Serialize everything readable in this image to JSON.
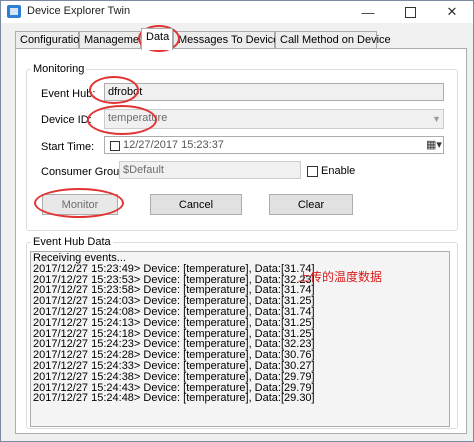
{
  "window": {
    "title": "Device Explorer Twin"
  },
  "tabs": [
    {
      "label": "Configuration"
    },
    {
      "label": "Management"
    },
    {
      "label": "Data"
    },
    {
      "label": "Messages To Device"
    },
    {
      "label": "Call Method on Device"
    }
  ],
  "monitoring": {
    "legend": "Monitoring",
    "event_hub_label": "Event Hub:",
    "event_hub_value": "dfrobot",
    "device_id_label": "Device ID:",
    "device_id_value": "temperature",
    "start_time_label": "Start Time:",
    "start_time_value": "12/27/2017 15:23:37",
    "consumer_group_label": "Consumer Group:",
    "consumer_group_value": "$Default",
    "enable_label": "Enable",
    "monitor_button": "Monitor",
    "cancel_button": "Cancel",
    "clear_button": "Clear"
  },
  "event_hub_data": {
    "legend": "Event Hub Data",
    "lines": [
      "Receiving events...",
      "2017/12/27 15:23:49> Device: [temperature], Data:[31.74]",
      "2017/12/27 15:23:53> Device: [temperature], Data:[32.23]",
      "2017/12/27 15:23:58> Device: [temperature], Data:[31.74]",
      "2017/12/27 15:24:03> Device: [temperature], Data:[31.25]",
      "2017/12/27 15:24:08> Device: [temperature], Data:[31.74]",
      "2017/12/27 15:24:13> Device: [temperature], Data:[31.25]",
      "2017/12/27 15:24:18> Device: [temperature], Data:[31.25]",
      "2017/12/27 15:24:23> Device: [temperature], Data:[32.23]",
      "2017/12/27 15:24:28> Device: [temperature], Data:[30.76]",
      "2017/12/27 15:24:33> Device: [temperature], Data:[30.27]",
      "2017/12/27 15:24:38> Device: [temperature], Data:[29.79]",
      "2017/12/27 15:24:43> Device: [temperature], Data:[29.79]",
      "2017/12/27 15:24:48> Device: [temperature], Data:[29.30]"
    ]
  },
  "annotation": {
    "text": "上传的温度数据",
    "color": "#d41a1a"
  },
  "colors": {
    "highlight_ring": "#e23333"
  }
}
